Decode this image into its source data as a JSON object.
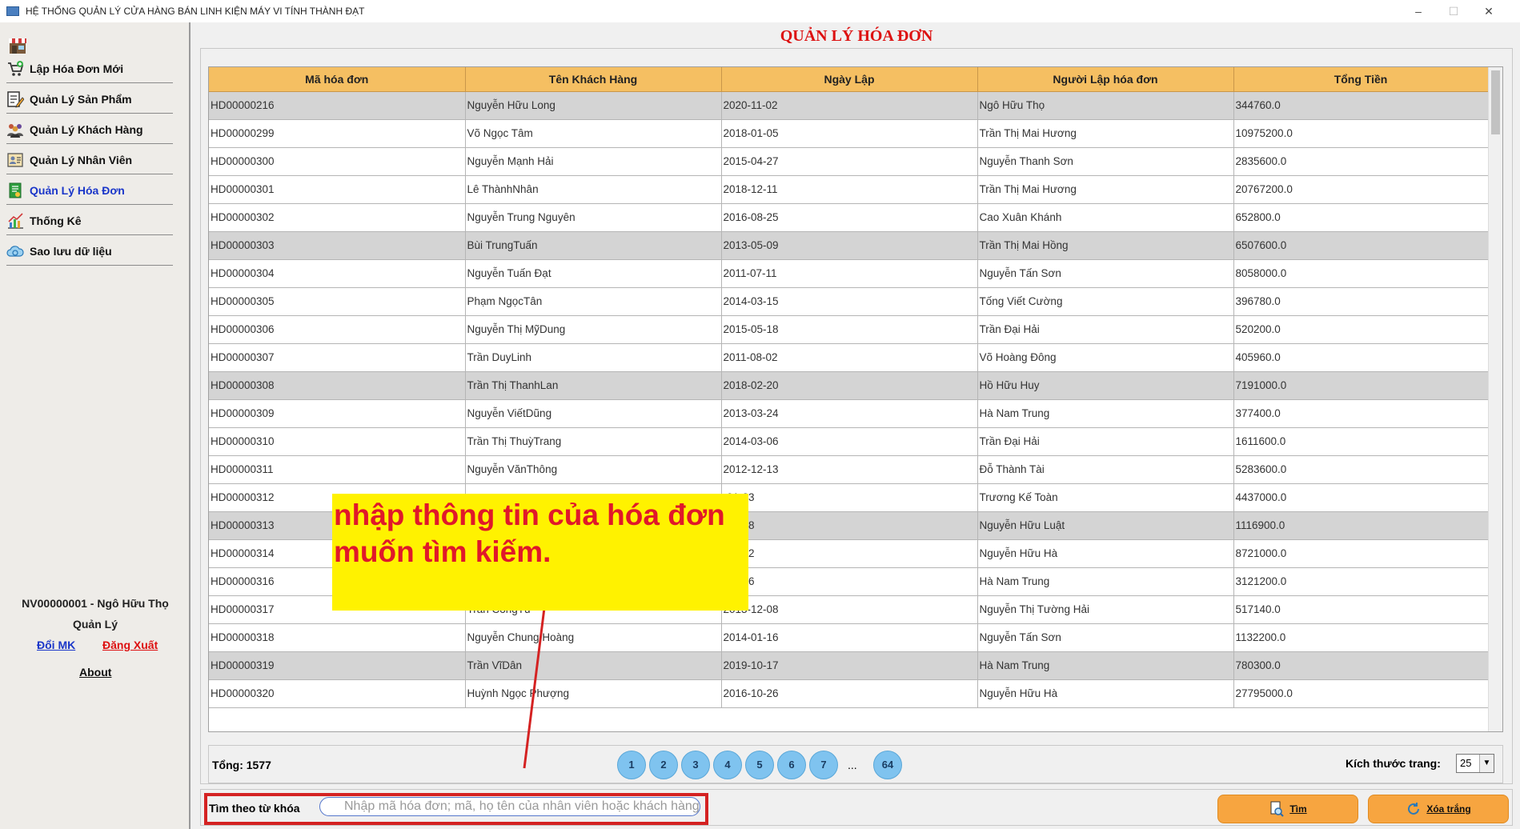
{
  "window": {
    "title": "HỆ THỐNG QUẢN LÝ CỬA HÀNG BÁN LINH KIỆN MÁY VI TÍNH THÀNH ĐẠT",
    "minimize": "–",
    "maximize": "☐",
    "close": "✕"
  },
  "sidebar": {
    "items": [
      {
        "label": "Lập Hóa Đơn Mới",
        "icon": "cart-icon"
      },
      {
        "label": "Quản Lý Sản Phẩm",
        "icon": "edit-list-icon"
      },
      {
        "label": "Quản Lý Khách Hàng",
        "icon": "group-icon"
      },
      {
        "label": "Quản Lý Nhân Viên",
        "icon": "id-card-icon"
      },
      {
        "label": "Quản Lý Hóa Đơn",
        "icon": "invoice-icon"
      },
      {
        "label": "Thống Kê",
        "icon": "chart-icon"
      },
      {
        "label": "Sao lưu dữ liệu",
        "icon": "cloud-backup-icon"
      }
    ],
    "user_line": "NV00000001 - Ngô Hữu  Thọ",
    "role": "Quản Lý",
    "change_password": "Đổi MK",
    "logout": "Đăng Xuất",
    "about": "About"
  },
  "main": {
    "title": "QUẢN LÝ HÓA ĐƠN",
    "columns": [
      "Mã hóa đơn",
      "Tên Khách Hàng",
      "Ngày Lập",
      "Người Lập hóa đơn",
      "Tổng Tiền"
    ],
    "rows": [
      [
        "HD00000216",
        "Nguyễn Hữu Long",
        "2020-11-02",
        "Ngô Hữu  Thọ",
        "344760.0"
      ],
      [
        "HD00000299",
        "Võ Ngọc Tâm",
        "2018-01-05",
        "Trần Thị Mai Hương",
        "10975200.0"
      ],
      [
        "HD00000300",
        "Nguyễn Mạnh Hải",
        "2015-04-27",
        "Nguyễn Thanh Sơn",
        "2835600.0"
      ],
      [
        "HD00000301",
        "Lê ThànhNhân",
        "2018-12-11",
        "Trần Thị Mai Hương",
        "20767200.0"
      ],
      [
        "HD00000302",
        "Nguyễn Trung Nguyên",
        "2016-08-25",
        "Cao Xuân  Khánh",
        "652800.0"
      ],
      [
        "HD00000303",
        "Bùi TrungTuấn",
        "2013-05-09",
        "Trần Thị Mai Hồng",
        "6507600.0"
      ],
      [
        "HD00000304",
        "Nguyễn Tuấn Đạt",
        "2011-07-11",
        "Nguyễn Tấn Sơn",
        "8058000.0"
      ],
      [
        "HD00000305",
        "Phạm NgọcTân",
        "2014-03-15",
        "Tống Viết Cường",
        "396780.0"
      ],
      [
        "HD00000306",
        "Nguyễn Thị MỹDung",
        "2015-05-18",
        "Trần Đại Hải",
        "520200.0"
      ],
      [
        "HD00000307",
        "Trần DuyLinh",
        "2011-08-02",
        "Võ Hoàng Đông",
        "405960.0"
      ],
      [
        "HD00000308",
        "Trần Thị ThanhLan",
        "2018-02-20",
        "Hồ Hữu  Huy",
        "7191000.0"
      ],
      [
        "HD00000309",
        "Nguyễn ViếtDũng",
        "2013-03-24",
        "Hà Nam  Trung",
        "377400.0"
      ],
      [
        "HD00000310",
        "Trần Thị ThuỳTrang",
        "2014-03-06",
        "Trần Đại Hải",
        "1611600.0"
      ],
      [
        "HD00000311",
        "Nguyễn VănThông",
        "2012-12-13",
        "Đỗ Thành Tài",
        "5283600.0"
      ],
      [
        "HD00000312",
        "",
        "-01-23",
        "Trương Kế Toàn",
        "4437000.0"
      ],
      [
        "HD00000313",
        "",
        "-04-18",
        "Nguyễn Hữu Luật",
        "1116900.0"
      ],
      [
        "HD00000314",
        "",
        "-02-22",
        "Nguyễn Hữu Hà",
        "8721000.0"
      ],
      [
        "HD00000316",
        "",
        "-04-26",
        "Hà Nam  Trung",
        "3121200.0"
      ],
      [
        "HD00000317",
        "Trần CôngTú",
        "2013-12-08",
        "Nguyễn Thị Tường Hải",
        "517140.0"
      ],
      [
        "HD00000318",
        "Nguyễn Chung Hoàng",
        "2014-01-16",
        "Nguyễn Tấn Sơn",
        "1132200.0"
      ],
      [
        "HD00000319",
        "Trần VĩDân",
        "2019-10-17",
        "Hà Nam  Trung",
        "780300.0"
      ],
      [
        "HD00000320",
        "Huỳnh Ngọc Phượng",
        "2016-10-26",
        "Nguyễn Hữu Hà",
        "27795000.0"
      ]
    ],
    "shaded_rows": [
      0,
      5,
      10,
      15,
      20
    ],
    "total_label": "Tổng: 1577",
    "pages": [
      "1",
      "2",
      "3",
      "4",
      "5",
      "6",
      "7"
    ],
    "ellipsis": "...",
    "last_page": "64",
    "page_size_label": "Kích thước trang:",
    "page_size_value": "25"
  },
  "search": {
    "label": "Tìm theo từ khóa",
    "placeholder": "Nhập mã hóa đơn; mã, họ tên của nhân viên hoặc khách hàng",
    "find_button": "Tìm",
    "clear_button": "Xóa trắng"
  },
  "annotation": {
    "text": "nhập thông tin của hóa đơn muốn tìm kiếm.",
    "color": "#e0182a",
    "background": "#fff200"
  }
}
